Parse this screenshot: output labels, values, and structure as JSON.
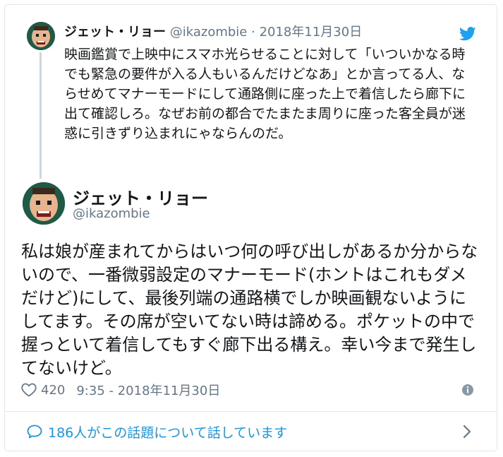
{
  "parent_tweet": {
    "name": "ジェット・リョー",
    "handle": "@ikazombie",
    "separator": "·",
    "date": "2018年11月30日",
    "text": "映画鑑賞で上映中にスマホ光らせることに対して「いついかなる時でも緊急の要件が入る人もいるんだけどなあ」とか言ってる人、ならせめてマナーモードにして通路側に座った上で着信したら廊下に出て確認しろ。なぜお前の都合でたまたま周りに座った客全員が迷惑に引きずり込まれにゃならんのだ。"
  },
  "main_tweet": {
    "name": "ジェット・リョー",
    "handle": "@ikazombie",
    "text": "私は娘が産まれてからはいつ何の呼び出しがあるか分からないので、一番微弱設定のマナーモード(ホントはこれもダメだけど)にして、最後列端の通路横でしか映画観ないようにしてます。その席が空いてない時は諦める。ポケットの中で握っといて着信してもすぐ廊下出る構え。幸い今まで発生してないけど。",
    "likes": "420",
    "timestamp": "9:35 - 2018年11月30日"
  },
  "footer": {
    "conversation_text": "186人がこの話題について話しています"
  },
  "icons": {
    "bird": "twitter-bird-icon",
    "heart": "heart-icon",
    "info": "info-icon",
    "bubble": "speech-bubble-icon",
    "chevron": "chevron-right-icon"
  },
  "colors": {
    "twitter_blue": "#1da1f2",
    "link_blue": "#1b95e0",
    "secondary_text": "#657786",
    "border": "#e1e8ed",
    "avatar_bg": "#1e5a46"
  }
}
